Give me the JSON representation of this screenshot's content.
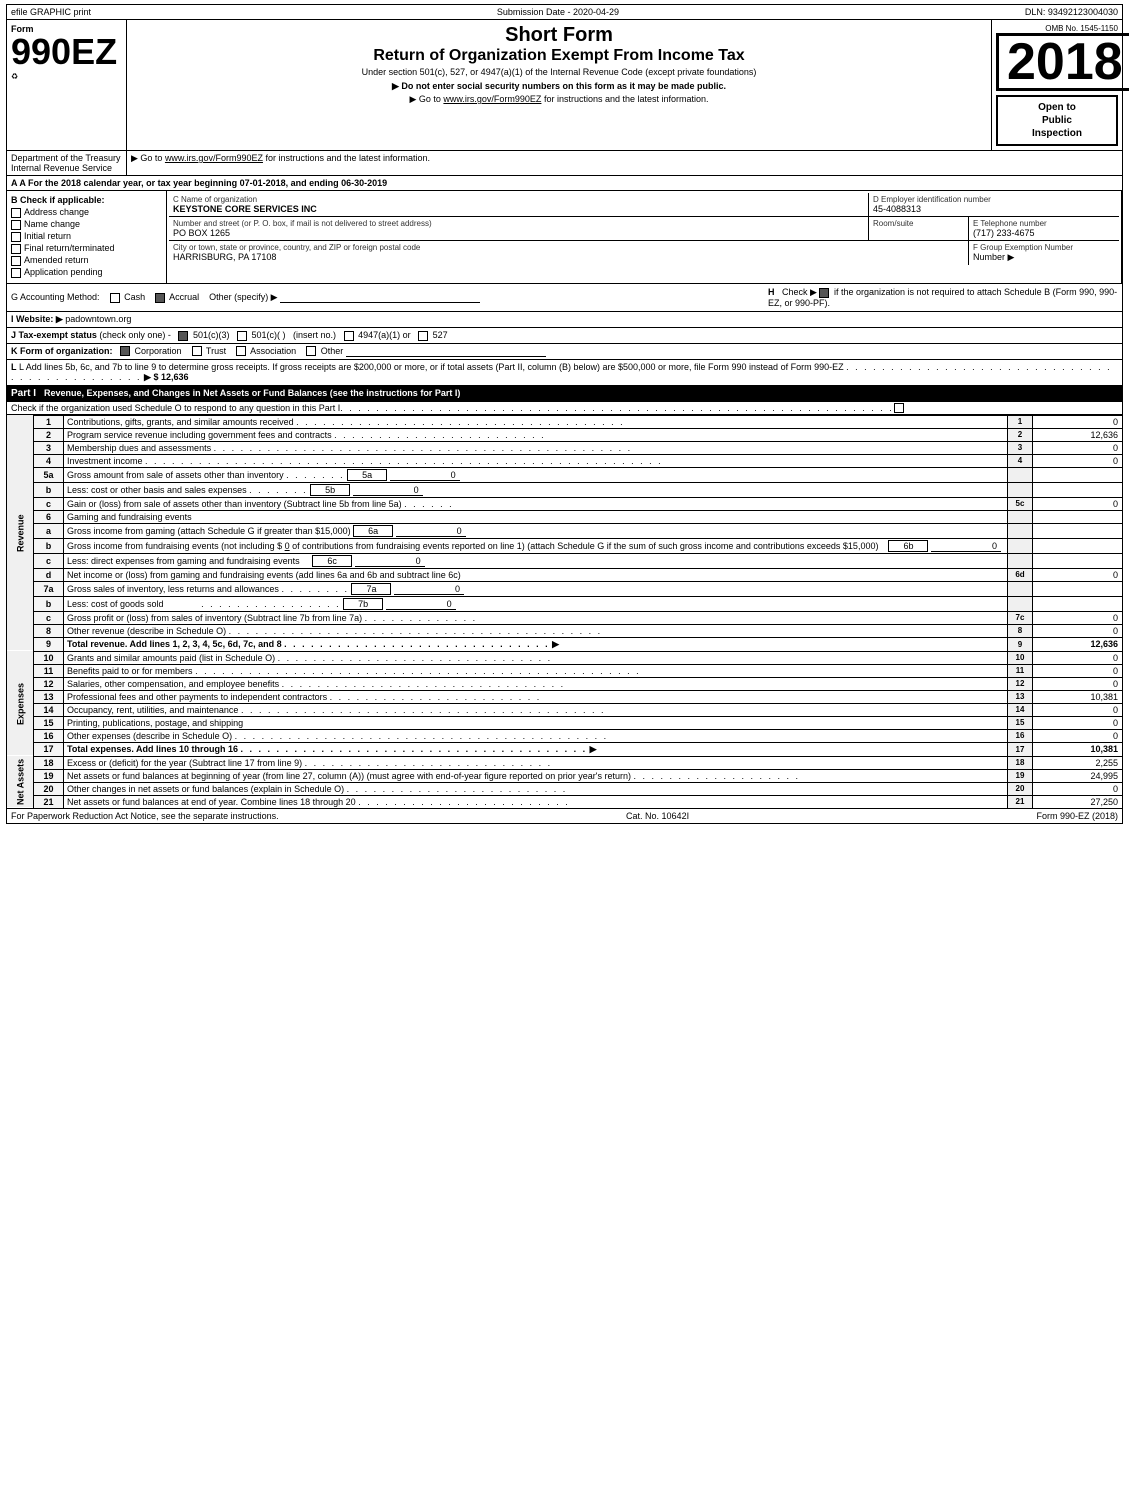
{
  "topbar": {
    "left": "efile GRAPHIC print",
    "middle": "Submission Date - 2020-04-29",
    "right": "DLN: 93492123004030"
  },
  "form": {
    "number": "990EZ",
    "sub_label": "Form",
    "omb": "OMB No. 1545-1150",
    "year": "2018",
    "short_form_title": "Short Form",
    "main_title": "Return of Organization Exempt From Income Tax",
    "under_title": "Under section 501(c), 527, or 4947(a)(1) of the Internal Revenue Code (except private foundations)",
    "notice_ssn": "▶ Do not enter social security numbers on this form as it may be made public.",
    "goto_text": "▶ Go to www.irs.gov/Form990EZ for instructions and the latest information.",
    "goto_url": "www.irs.gov/Form990EZ",
    "open_to_public": "Open to\nPublic\nInspection"
  },
  "dept": {
    "label": "Department of the Treasury",
    "internal_revenue": "Internal Revenue Service"
  },
  "taxyear": {
    "text": "A For the 2018 calendar year, or tax year beginning 07-01-2018",
    "ending": ", and ending 06-30-2019"
  },
  "checks": {
    "b_label": "B Check if applicable:",
    "address_change": "Address change",
    "name_change": "Name change",
    "initial_return": "Initial return",
    "final_return": "Final return/terminated",
    "amended_return": "Amended return",
    "application_pending": "Application pending"
  },
  "org": {
    "c_label": "C Name of organization",
    "name": "KEYSTONE CORE SERVICES INC",
    "d_label": "D Employer identification number",
    "ein": "45-4088313",
    "street_label": "Number and street (or P. O. box, if mail is not delivered to street address)",
    "street": "PO BOX 1265",
    "room_label": "Room/suite",
    "room": "",
    "e_label": "E Telephone number",
    "phone": "(717) 233-4675",
    "city_label": "City or town, state or province, country, and ZIP or foreign postal code",
    "city": "HARRISBURG, PA  17108",
    "f_label": "F Group Exemption Number",
    "group_exemption": ""
  },
  "accounting": {
    "g_label": "G Accounting Method:",
    "cash_label": "Cash",
    "accrual_label": "Accrual",
    "other_label": "Other (specify) ▶",
    "accrual_checked": true,
    "h_label": "H  Check ▶",
    "h_text": "if the organization is not required to attach Schedule B (Form 990, 990-EZ, or 990-PF).",
    "h_checked": true
  },
  "website": {
    "i_label": "I Website: ▶",
    "url": "padowntown.org"
  },
  "taxexempt": {
    "j_label": "J Tax-exempt status",
    "j_note": "(check only one) -",
    "c3": "501(c)(3)",
    "cc": "501(c)(  )",
    "insert": "(insert no.)",
    "c4947": "4947(a)(1) or",
    "c527": "527",
    "c3_checked": true
  },
  "formorg": {
    "k_label": "K Form of organization:",
    "corp": "Corporation",
    "trust": "Trust",
    "assoc": "Association",
    "other": "Other",
    "corp_checked": true
  },
  "l_row": {
    "text": "L Add lines 5b, 6c, and 7b to line 9 to determine gross receipts. If gross receipts are $200,000 or more, or if total assets (Part II, column (B) below) are $500,000 or more, file Form 990 instead of Form 990-EZ",
    "dots": ".",
    "amount": "▶ $ 12,636"
  },
  "part1": {
    "label": "Part I",
    "title": "Revenue, Expenses, and Changes in Net Assets or Fund Balances",
    "instructions": "(see the instructions for Part I)",
    "schedule_o_check": "Check if the organization used Schedule O to respond to any question in this Part I",
    "dots": ".",
    "check_val": "0"
  },
  "revenue_rows": [
    {
      "num": "1",
      "desc": "Contributions, gifts, grants, and similar amounts received",
      "dots": true,
      "line_label": "1",
      "value": "0"
    },
    {
      "num": "2",
      "desc": "Program service revenue including government fees and contracts",
      "dots": true,
      "line_label": "2",
      "value": "12,636"
    },
    {
      "num": "3",
      "desc": "Membership dues and assessments",
      "dots": true,
      "line_label": "3",
      "value": "0"
    },
    {
      "num": "4",
      "desc": "Investment income",
      "dots": true,
      "line_label": "4",
      "value": "0"
    }
  ],
  "line5": {
    "a_num": "5a",
    "a_desc": "Gross amount from sale of assets other than inventory",
    "a_mid_label": "5a",
    "a_mid_val": "0",
    "b_num": "b",
    "b_desc": "Less: cost or other basis and sales expenses",
    "b_mid_label": "5b",
    "b_mid_val": "0",
    "c_num": "c",
    "c_desc": "Gain or (loss) from sale of assets other than inventory (Subtract line 5b from line 5a)",
    "c_dots": true,
    "c_line_label": "5c",
    "c_value": "0"
  },
  "line6": {
    "header_num": "6",
    "header_desc": "Gaming and fundraising events",
    "a_num": "a",
    "a_desc": "Gross income from gaming (attach Schedule G if greater than $15,000)",
    "a_mid_label": "6a",
    "a_mid_val": "0",
    "b_num": "b",
    "b_desc1": "Gross income from fundraising events (not including $",
    "b_amount": "0",
    "b_desc2": "of contributions from fundraising events reported on line 1) (attach Schedule G if the sum of such gross income and contributions exceeds $15,000)",
    "b_mid_label": "6b",
    "b_mid_val": "0",
    "c_num": "c",
    "c_desc": "Less: direct expenses from gaming and fundraising events",
    "c_mid_label": "6c",
    "c_mid_val": "0",
    "d_num": "d",
    "d_desc": "Net income or (loss) from gaming and fundraising events (add lines 6a and 6b and subtract line 6c)",
    "d_line_label": "6d",
    "d_value": "0"
  },
  "line7": {
    "a_num": "7a",
    "a_desc": "Gross sales of inventory, less returns and allowances",
    "a_dots": true,
    "a_mid_label": "7a",
    "a_mid_val": "0",
    "b_num": "b",
    "b_desc": "Less: cost of goods sold",
    "b_dots": true,
    "b_mid_label": "7b",
    "b_mid_val": "0",
    "c_num": "c",
    "c_desc": "Gross profit or (loss) from sales of inventory (Subtract line 7b from line 7a)",
    "c_dots": true,
    "c_line_label": "7c",
    "c_value": "0"
  },
  "lines8_9": [
    {
      "num": "8",
      "desc": "Other revenue (describe in Schedule O)",
      "dots": true,
      "line_label": "8",
      "value": "0"
    },
    {
      "num": "9",
      "desc": "Total revenue. Add lines 1, 2, 3, 4, 5c, 6d, 7c, and 8",
      "dots": true,
      "arrow": "▶",
      "bold": true,
      "line_label": "9",
      "value": "12,636"
    }
  ],
  "expense_rows": [
    {
      "num": "10",
      "desc": "Grants and similar amounts paid (list in Schedule O)",
      "dots": true,
      "line_label": "10",
      "value": "0"
    },
    {
      "num": "11",
      "desc": "Benefits paid to or for members",
      "dots": true,
      "line_label": "11",
      "value": "0"
    },
    {
      "num": "12",
      "desc": "Salaries, other compensation, and employee benefits",
      "dots": true,
      "line_label": "12",
      "value": "0"
    },
    {
      "num": "13",
      "desc": "Professional fees and other payments to independent contractors",
      "dots": true,
      "line_label": "13",
      "value": "10,381"
    },
    {
      "num": "14",
      "desc": "Occupancy, rent, utilities, and maintenance",
      "dots": true,
      "line_label": "14",
      "value": "0"
    },
    {
      "num": "15",
      "desc": "Printing, publications, postage, and shipping",
      "dots": false,
      "line_label": "15",
      "value": "0"
    },
    {
      "num": "16",
      "desc": "Other expenses (describe in Schedule O)",
      "dots": true,
      "line_label": "16",
      "value": "0"
    },
    {
      "num": "17",
      "desc": "Total expenses. Add lines 10 through 16",
      "dots": true,
      "arrow": "▶",
      "bold": true,
      "line_label": "17",
      "value": "10,381"
    }
  ],
  "netasset_rows": [
    {
      "num": "18",
      "desc": "Excess or (deficit) for the year (Subtract line 17 from line 9)",
      "dots": true,
      "line_label": "18",
      "value": "2,255"
    },
    {
      "num": "19",
      "desc": "Net assets or fund balances at beginning of year (from line 27, column (A)) (must agree with end-of-year figure reported on prior year's return)",
      "dots": true,
      "line_label": "19",
      "value": "24,995"
    },
    {
      "num": "20",
      "desc": "Other changes in net assets or fund balances (explain in Schedule O)",
      "dots": true,
      "line_label": "20",
      "value": "0"
    },
    {
      "num": "21",
      "desc": "Net assets or fund balances at end of year. Combine lines 18 through 20",
      "dots": true,
      "line_label": "21",
      "value": "27,250"
    }
  ],
  "footer": {
    "left": "For Paperwork Reduction Act Notice, see the separate instructions.",
    "middle": "Cat. No. 10642I",
    "right": "Form 990-EZ (2018)"
  }
}
